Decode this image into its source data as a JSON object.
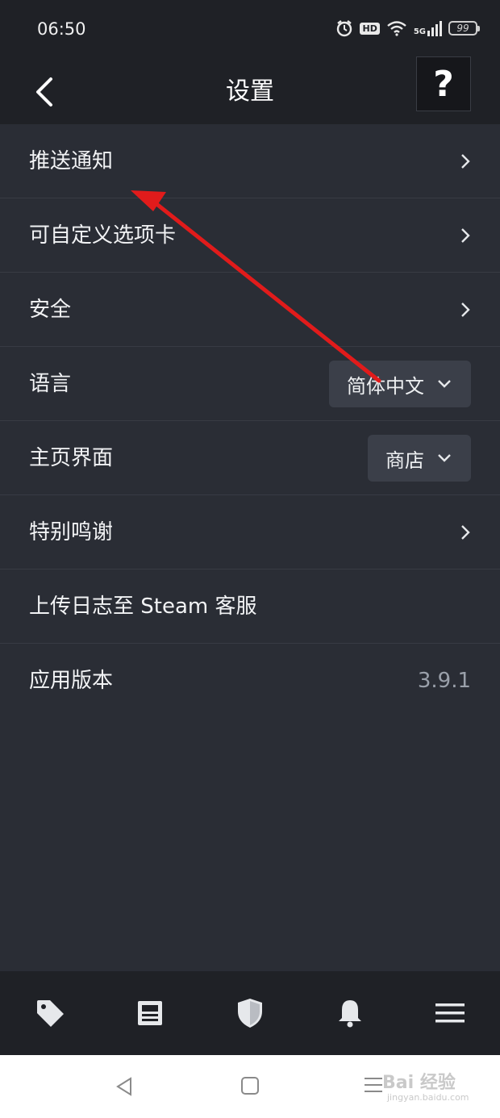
{
  "status_bar": {
    "time": "06:50",
    "hd": "HD",
    "network": "5G",
    "battery": "99"
  },
  "header": {
    "title": "设置",
    "help_label": "?"
  },
  "settings": {
    "items": [
      {
        "label": "推送通知"
      },
      {
        "label": "可自定义选项卡"
      },
      {
        "label": "安全"
      },
      {
        "label": "语言",
        "selected": "简体中文"
      },
      {
        "label": "主页界面",
        "selected": "商店"
      },
      {
        "label": "特别鸣谢"
      },
      {
        "label": "上传日志至 Steam 客服"
      },
      {
        "label": "应用版本",
        "value": "3.9.1"
      }
    ]
  },
  "bottom_nav": [
    "tag-icon",
    "news-icon",
    "shield-icon",
    "bell-icon",
    "menu-icon"
  ],
  "watermark": {
    "text": "Bai 经验",
    "sub": "jingyan.baidu.com"
  },
  "colors": {
    "background": "#2a2d35",
    "bar": "#1f2126",
    "annotation_arrow": "#e11b1b"
  }
}
